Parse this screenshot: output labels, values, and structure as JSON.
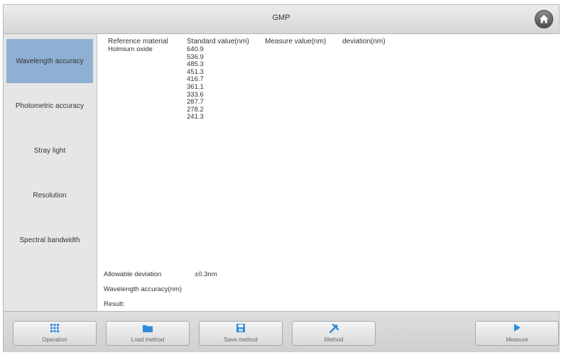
{
  "header": {
    "title": "GMP"
  },
  "sidebar": {
    "items": [
      {
        "label": "Wavelength accuracy"
      },
      {
        "label": "Photometric accuracy"
      },
      {
        "label": "Stray light"
      },
      {
        "label": "Resolution"
      },
      {
        "label": "Spectral bandwidth"
      }
    ],
    "active_index": 0
  },
  "table": {
    "headers": [
      "Reference material",
      "Standard value(nm)",
      "Measure value(nm)",
      "deviation(nm)"
    ],
    "material": "Holmium oxide",
    "standard_values": [
      "640.9",
      "536.9",
      "485.3",
      "451.3",
      "416.7",
      "361.1",
      "333.6",
      "287.7",
      "278.2",
      "241.3"
    ]
  },
  "footer": {
    "allowable_deviation_label": "Allowable deviation",
    "allowable_deviation_value": "±0.3nm",
    "wavelength_accuracy_label": "Wavelength accuracy(nm)",
    "result_label": "Result:"
  },
  "toolbar": {
    "operation": "Operation",
    "load_method": "Load method",
    "save_method": "Save method",
    "method": "Method",
    "measure": "Measure"
  },
  "colors": {
    "accent": "#2f8bd8",
    "sidebar_active": "#8fb0d3"
  },
  "icons": {
    "home": "home-icon",
    "operation": "grid-icon",
    "load_method": "folder-icon",
    "save_method": "save-icon",
    "method": "tools-icon",
    "measure": "play-icon"
  }
}
